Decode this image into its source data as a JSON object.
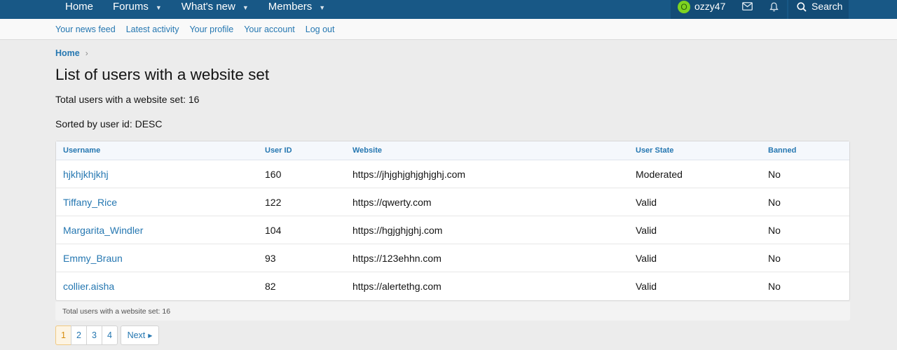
{
  "nav": {
    "tabs": [
      {
        "label": "Home",
        "has_menu": false
      },
      {
        "label": "Forums",
        "has_menu": true
      },
      {
        "label": "What's new",
        "has_menu": true
      },
      {
        "label": "Members",
        "has_menu": true
      }
    ],
    "user": {
      "initial": "O",
      "name": "ozzy47"
    },
    "search_label": "Search"
  },
  "subnav": [
    "Your news feed",
    "Latest activity",
    "Your profile",
    "Your account",
    "Log out"
  ],
  "breadcrumb": {
    "home": "Home",
    "separator": "›"
  },
  "page": {
    "title": "List of users with a website set",
    "total_line": "Total users with a website set: 16",
    "sorted_line": "Sorted by user id: DESC"
  },
  "table": {
    "headers": [
      "Username",
      "User ID",
      "Website",
      "User State",
      "Banned"
    ],
    "rows": [
      {
        "username": "hjkhjkhjkhj",
        "user_id": "160",
        "website": "https://jhjghjghjghjghj.com",
        "state": "Moderated",
        "banned": "No"
      },
      {
        "username": "Tiffany_Rice",
        "user_id": "122",
        "website": "https://qwerty.com",
        "state": "Valid",
        "banned": "No"
      },
      {
        "username": "Margarita_Windler",
        "user_id": "104",
        "website": "https://hgjghjghj.com",
        "state": "Valid",
        "banned": "No"
      },
      {
        "username": "Emmy_Braun",
        "user_id": "93",
        "website": "https://123ehhn.com",
        "state": "Valid",
        "banned": "No"
      },
      {
        "username": "collier.aisha",
        "user_id": "82",
        "website": "https://alertethg.com",
        "state": "Valid",
        "banned": "No"
      }
    ],
    "footer": "Total users with a website set: 16"
  },
  "pagination": {
    "pages": [
      "1",
      "2",
      "3",
      "4"
    ],
    "current": "1",
    "next_label": "Next"
  },
  "colors": {
    "nav_bg": "#185886",
    "link": "#2577b1",
    "avatar": "#7ed321",
    "current_page": "#fdf4e3"
  }
}
